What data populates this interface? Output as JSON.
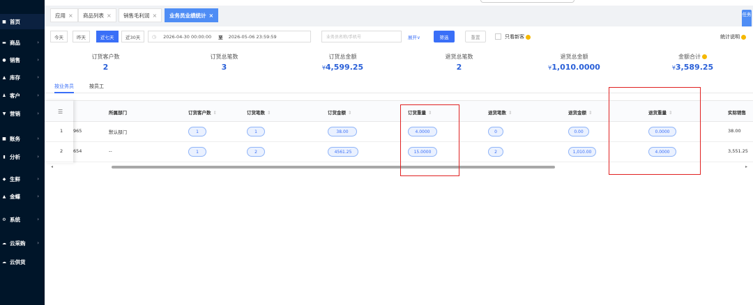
{
  "sidebar": {
    "items": [
      {
        "label": "首页",
        "icon": "home-icon",
        "arrow": false
      },
      {
        "label": "商品",
        "icon": "goods-icon",
        "arrow": true
      },
      {
        "label": "销售",
        "icon": "sales-icon",
        "arrow": true
      },
      {
        "label": "库存",
        "icon": "inventory-icon",
        "arrow": true
      },
      {
        "label": "客户",
        "icon": "customer-icon",
        "arrow": true
      },
      {
        "label": "营销",
        "icon": "marketing-icon",
        "arrow": true
      },
      {
        "label": "账务",
        "icon": "accounting-icon",
        "arrow": true
      },
      {
        "label": "分析",
        "icon": "analysis-icon",
        "arrow": true
      },
      {
        "label": "生鲜",
        "icon": "fresh-icon",
        "arrow": true
      },
      {
        "label": "金蝶",
        "icon": "kingdee-icon",
        "arrow": true
      },
      {
        "label": "系统",
        "icon": "system-icon",
        "arrow": true
      },
      {
        "label": "云采购",
        "icon": "cloud-purchase-icon",
        "arrow": true
      },
      {
        "label": "云供货",
        "icon": "cloud-supply-icon",
        "arrow": false
      }
    ]
  },
  "tabs": [
    {
      "label": "应用"
    },
    {
      "label": "商品列表"
    },
    {
      "label": "销售毛利润"
    },
    {
      "label": "业务员业绩统计"
    }
  ],
  "task_button": {
    "label": "任务"
  },
  "filter": {
    "ranges": [
      "今天",
      "昨天",
      "近七天",
      "近30天"
    ],
    "date_start": "2026-04-30 00:00:00",
    "date_sep": "至",
    "date_end": "2026-05-06 23:59:59",
    "keyword_placeholder": "业务员名称/手机号",
    "expand_label": "展开∨",
    "filter_label": "筛选",
    "reset_label": "重置",
    "new_customer_label": "只看新客",
    "stat_note": "统计说明"
  },
  "summary": [
    {
      "label": "订货客户数",
      "value": "2",
      "currency": ""
    },
    {
      "label": "订货总笔数",
      "value": "3",
      "currency": ""
    },
    {
      "label": "订货总金额",
      "value": "4,599.25",
      "currency": "¥"
    },
    {
      "label": "退货总笔数",
      "value": "2",
      "currency": ""
    },
    {
      "label": "退货总金额",
      "value": "1,010.0000",
      "currency": "¥"
    },
    {
      "label": "金额合计",
      "value": "3,589.25",
      "currency": "¥"
    }
  ],
  "subtabs": [
    "按业务员",
    "按员工"
  ],
  "table": {
    "columns": [
      "所属部门",
      "订货客户数",
      "订货笔数",
      "订货金额",
      "订货重量",
      "退货笔数",
      "退货金额",
      "退货重量",
      "实际销售"
    ],
    "rows": [
      {
        "index": "1",
        "id": "965",
        "dept": "默认部门",
        "cust": "1",
        "orders": "1",
        "amount": "38.00",
        "weight": "4.0000",
        "ret_orders": "0",
        "ret_amount": "0.00",
        "ret_weight": "0.0000",
        "actual": "38.00"
      },
      {
        "index": "2",
        "id": "654",
        "dept": "--",
        "cust": "1",
        "orders": "2",
        "amount": "4561.25",
        "weight": "15.0000",
        "ret_orders": "2",
        "ret_amount": "1,010.00",
        "ret_weight": "4.0000",
        "actual": "3,551.25"
      }
    ]
  },
  "colors": {
    "accent": "#3a6ff7",
    "sidebar": "#001529",
    "highlight": "#e02020",
    "value": "#2a60d8"
  }
}
